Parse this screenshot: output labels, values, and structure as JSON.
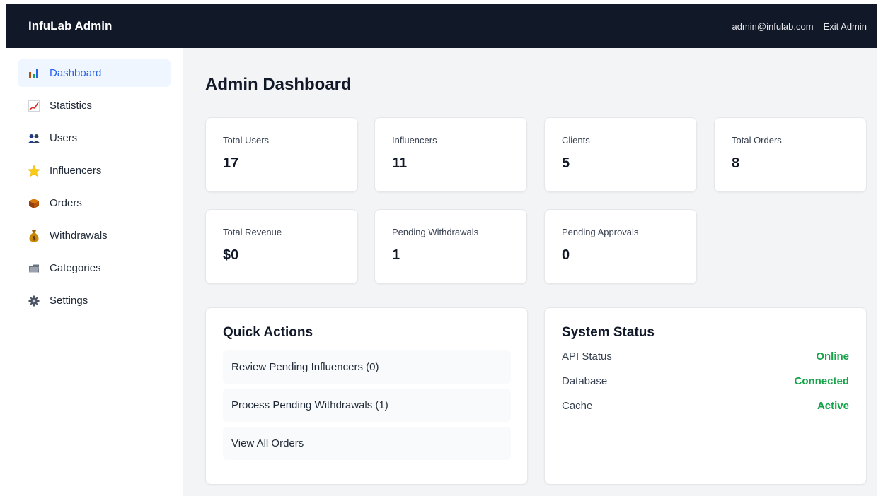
{
  "header": {
    "brand": "InfuLab Admin",
    "email": "admin@infulab.com",
    "exit_label": "Exit Admin"
  },
  "sidebar": {
    "items": [
      {
        "label": "Dashboard",
        "icon": "bar-chart-icon",
        "active": true
      },
      {
        "label": "Statistics",
        "icon": "trend-chart-icon"
      },
      {
        "label": "Users",
        "icon": "users-icon"
      },
      {
        "label": "Influencers",
        "icon": "star-icon"
      },
      {
        "label": "Orders",
        "icon": "package-icon"
      },
      {
        "label": "Withdrawals",
        "icon": "money-bag-icon"
      },
      {
        "label": "Categories",
        "icon": "folder-icon"
      },
      {
        "label": "Settings",
        "icon": "gear-icon"
      }
    ]
  },
  "main": {
    "title": "Admin Dashboard",
    "stats": [
      {
        "label": "Total Users",
        "value": "17"
      },
      {
        "label": "Influencers",
        "value": "11"
      },
      {
        "label": "Clients",
        "value": "5"
      },
      {
        "label": "Total Orders",
        "value": "8"
      },
      {
        "label": "Total Revenue",
        "value": "$0"
      },
      {
        "label": "Pending Withdrawals",
        "value": "1"
      },
      {
        "label": "Pending Approvals",
        "value": "0"
      }
    ],
    "quick_actions": {
      "title": "Quick Actions",
      "items": [
        "Review Pending Influencers (0)",
        "Process Pending Withdrawals (1)",
        "View All Orders"
      ]
    },
    "system_status": {
      "title": "System Status",
      "rows": [
        {
          "label": "API Status",
          "value": "Online"
        },
        {
          "label": "Database",
          "value": "Connected"
        },
        {
          "label": "Cache",
          "value": "Active"
        }
      ]
    }
  },
  "colors": {
    "topbar": "#111827",
    "accent": "#2563eb",
    "status_ok": "#16a34a"
  }
}
